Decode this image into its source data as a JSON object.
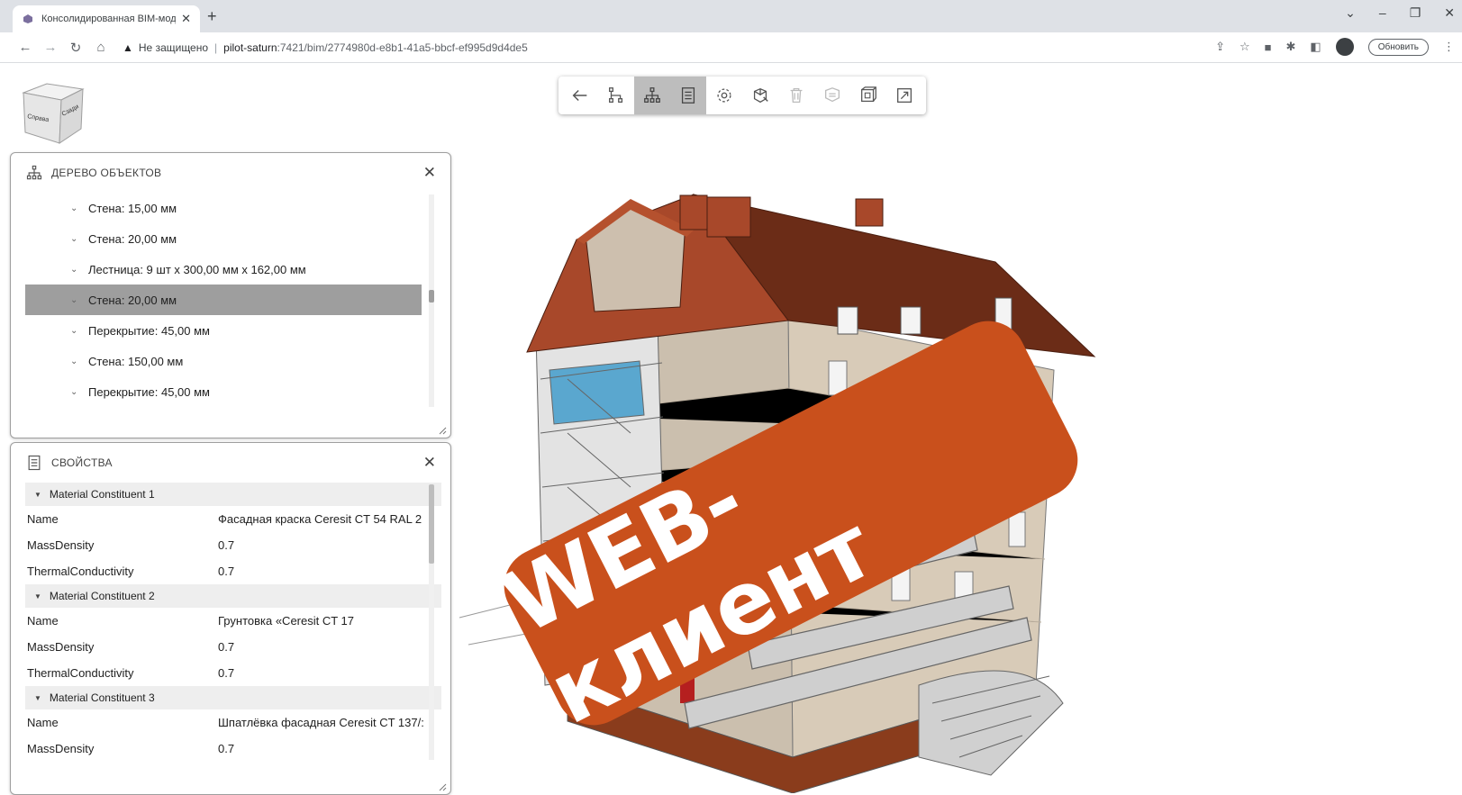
{
  "browser": {
    "tab_title": "Консолидированная BIM-модель",
    "address": {
      "security_label": "Не защищено",
      "host": "pilot-saturn",
      "path": ":7421/bim/2774980d-e8b1-41a5-bbcf-ef995d9d4de5"
    },
    "update_button": "Обновить"
  },
  "nav_cube": {
    "faces": [
      "Справа",
      "Сзади"
    ]
  },
  "viewer_toolbar": {
    "tools": [
      {
        "name": "back-arrow-icon",
        "active": false
      },
      {
        "name": "hierarchy-path-icon",
        "active": false
      },
      {
        "name": "object-tree-icon",
        "active": true
      },
      {
        "name": "properties-icon",
        "active": true
      },
      {
        "name": "settings-gear-icon",
        "active": false
      },
      {
        "name": "section-box-icon",
        "active": false
      },
      {
        "name": "trash-icon",
        "active": false
      },
      {
        "name": "layers-icon",
        "active": false
      },
      {
        "name": "cube-view-icon",
        "active": false
      },
      {
        "name": "fullscreen-icon",
        "active": false
      }
    ]
  },
  "tree_panel": {
    "title": "ДЕРЕВО ОБЪЕКТОВ",
    "items": [
      {
        "label": "Стена: 15,00 мм",
        "selected": false
      },
      {
        "label": "Стена: 20,00 мм",
        "selected": false
      },
      {
        "label": "Лестница: 9 шт x 300,00 мм x 162,00 мм",
        "selected": false
      },
      {
        "label": "Стена: 20,00 мм",
        "selected": true
      },
      {
        "label": "Перекрытие: 45,00 мм",
        "selected": false
      },
      {
        "label": "Стена: 150,00 мм",
        "selected": false
      },
      {
        "label": "Перекрытие: 45,00 мм",
        "selected": false
      }
    ]
  },
  "props_panel": {
    "title": "СВОЙСТВА",
    "groups": [
      {
        "name": "Material Constituent 1",
        "props": [
          {
            "key": "Name",
            "value": "Фасадная краска Ceresit CT 54 RAL 2"
          },
          {
            "key": "MassDensity",
            "value": "0.7"
          },
          {
            "key": "ThermalConductivity",
            "value": "0.7"
          }
        ]
      },
      {
        "name": "Material Constituent 2",
        "props": [
          {
            "key": "Name",
            "value": "Грунтовка «Ceresit CT 17"
          },
          {
            "key": "MassDensity",
            "value": "0.7"
          },
          {
            "key": "ThermalConductivity",
            "value": "0.7"
          }
        ]
      },
      {
        "name": "Material Constituent 3",
        "props": [
          {
            "key": "Name",
            "value": "Шпатлёвка фасадная Ceresit CT 137/:"
          },
          {
            "key": "MassDensity",
            "value": "0.7"
          }
        ]
      }
    ]
  },
  "promo_badge": {
    "text": "WEB-клиент",
    "color": "#c9501c"
  },
  "colors": {
    "roof": "#8b3a1e",
    "facade": "#d8cbb8",
    "selection": "#9e9e9e"
  }
}
